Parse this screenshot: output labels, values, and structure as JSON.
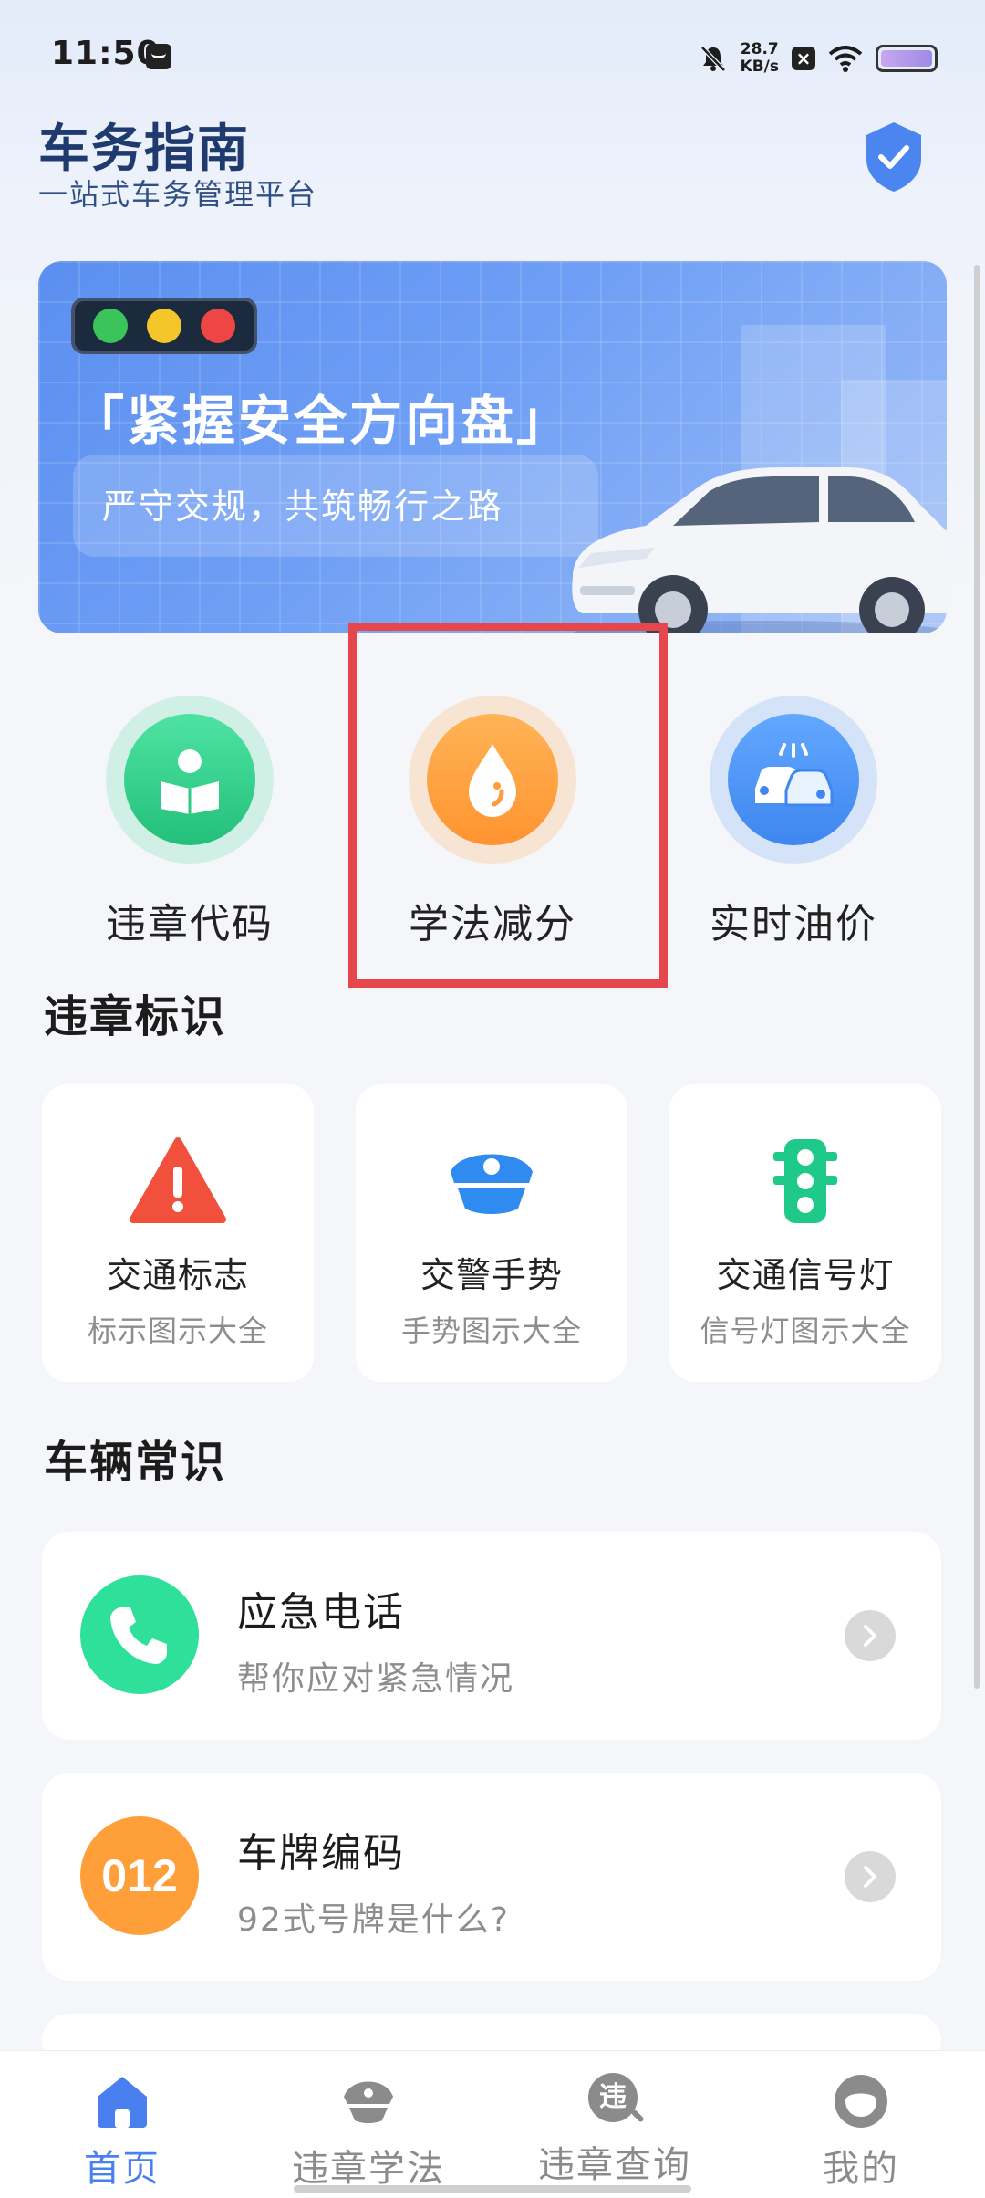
{
  "status_bar": {
    "time": "11:50",
    "speed_value": "28.7",
    "speed_unit": "KB/s"
  },
  "header": {
    "title": "车务指南",
    "subtitle": "一站式车务管理平台"
  },
  "banner": {
    "headline": "「紧握安全方向盘」",
    "subline": "严守交规，共筑畅行之路"
  },
  "quick_entries": [
    {
      "label": "违章代码",
      "icon": "reading-person-icon",
      "color": "#2fd08a"
    },
    {
      "label": "学法减分",
      "icon": "droplet-icon",
      "color": "#ff9f3a"
    },
    {
      "label": "实时油价",
      "icon": "car-collision-icon",
      "color": "#4a90f5"
    }
  ],
  "sign_section": {
    "title": "违章标识",
    "cards": [
      {
        "title": "交通标志",
        "sub": "标示图示大全",
        "icon": "warning-triangle-icon"
      },
      {
        "title": "交警手势",
        "sub": "手势图示大全",
        "icon": "police-cap-icon"
      },
      {
        "title": "交通信号灯",
        "sub": "信号灯图示大全",
        "icon": "traffic-light-icon"
      }
    ]
  },
  "vehicle_section": {
    "title": "车辆常识",
    "items": [
      {
        "title": "应急电话",
        "sub": "帮你应对紧急情况",
        "icon": "phone-icon",
        "color": "#2fd08a"
      },
      {
        "title": "车牌编码",
        "sub": "92式号牌是什么?",
        "icon_text": "012",
        "color": "#ff9f3a"
      }
    ]
  },
  "bottom_nav": [
    {
      "label": "首页",
      "icon": "home-icon",
      "active": true
    },
    {
      "label": "违章学法",
      "icon": "police-cap-icon"
    },
    {
      "label": "违章查询",
      "icon_text": "违",
      "icon": "search-violation-icon"
    },
    {
      "label": "我的",
      "icon": "profile-icon"
    }
  ],
  "colors": {
    "accent": "#4a7ff0",
    "highlight": "#e5474c",
    "brand_dark": "#1e3a6e"
  }
}
